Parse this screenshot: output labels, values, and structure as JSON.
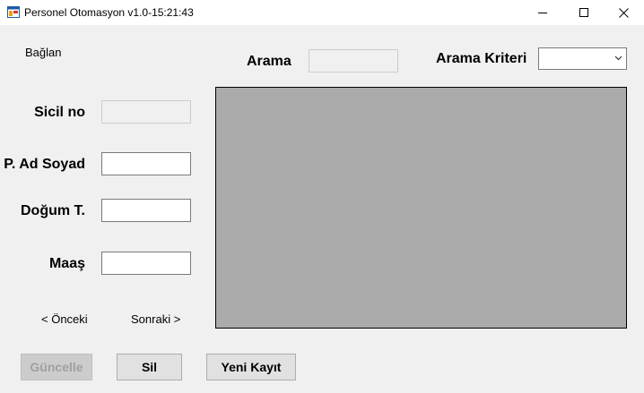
{
  "window": {
    "title": "Personel Otomasyon v1.0-15:21:43",
    "controls": [
      "minimize-icon",
      "maximize-icon",
      "close-icon"
    ]
  },
  "menu": {
    "connect_label": "Bağlan"
  },
  "search": {
    "label": "Arama",
    "value": "",
    "criteria_label": "Arama Kriteri",
    "criteria_selected": ""
  },
  "form": {
    "sicil_label": "Sicil no",
    "sicil_value": "",
    "adsoyad_label": "P. Ad Soyad",
    "adsoyad_value": "",
    "dogum_label": "Doğum T.",
    "dogum_value": "",
    "maas_label": "Maaş",
    "maas_value": ""
  },
  "nav": {
    "prev_label": "< Önceki",
    "next_label": "Sonraki >"
  },
  "actions": {
    "update_label": "Güncelle",
    "delete_label": "Sil",
    "new_label": "Yeni Kayıt"
  },
  "colors": {
    "window_bg": "#f0f0f0",
    "grid_bg": "#ababab"
  }
}
